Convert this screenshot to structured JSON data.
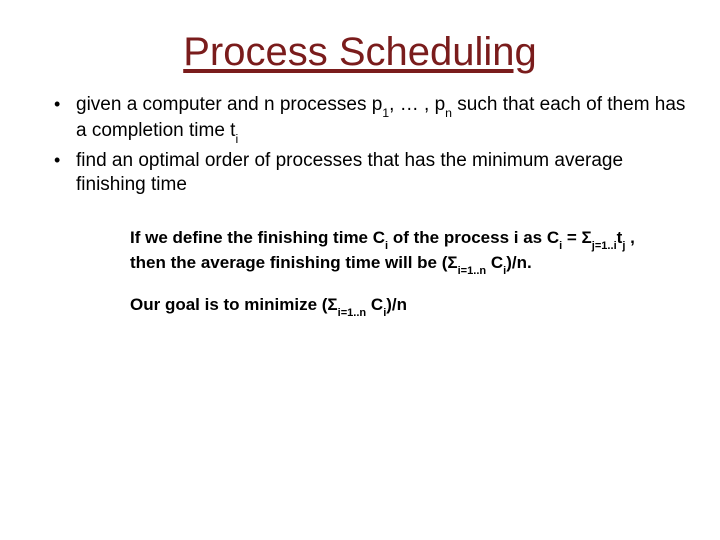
{
  "title": "Process Scheduling",
  "bullets": [
    {
      "pre": "given a computer and n processes p",
      "s1": "1",
      "mid1": ", … , p",
      "s2": "n",
      "mid2": " such that each of them has a completion time t",
      "s3": "i",
      "post": ""
    },
    {
      "pre": "find an optimal order of processes that has the minimum average finishing time",
      "s1": "",
      "mid1": "",
      "s2": "",
      "mid2": "",
      "s3": "",
      "post": ""
    }
  ],
  "para1": {
    "t1": "If we define the finishing time C",
    "s1": "i",
    "t2": " of the process i as C",
    "s2": "i",
    "t3": " = Σ",
    "s3": "j=1..i",
    "t4": "t",
    "s4": "j",
    "t5": " , then the average finishing time will be  (Σ",
    "s5": "i=1..n",
    "t6": " C",
    "s6": "i",
    "t7": ")/n."
  },
  "para2": {
    "t1": "Our goal is to minimize (Σ",
    "s1": "i=1..n",
    "t2": " C",
    "s2": "i",
    "t3": ")/n"
  }
}
